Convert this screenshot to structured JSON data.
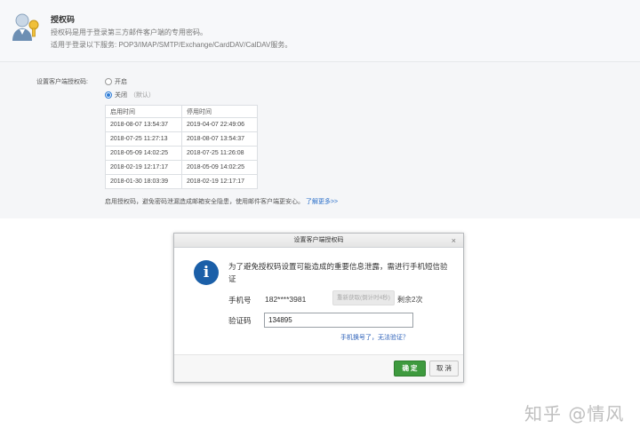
{
  "header": {
    "title": "授权码",
    "desc1": "授权码是用于登录第三方邮件客户端的专用密码。",
    "desc2": "适用于登录以下服务: POP3/IMAP/SMTP/Exchange/CardDAV/CalDAV服务。"
  },
  "setting": {
    "label": "设置客户端授权码:",
    "option_on": "开启",
    "option_off": "关闭",
    "option_off_hint": "（默认）",
    "selected": "关闭"
  },
  "history_table": {
    "headers": [
      "启用时间",
      "停用时间"
    ],
    "rows": [
      [
        "2018-08-07 13:54:37",
        "2019-04-07 22:49:06"
      ],
      [
        "2018-07-25 11:27:13",
        "2018-08-07 13:54:37"
      ],
      [
        "2018-05-09 14:02:25",
        "2018-07-25 11:26:08"
      ],
      [
        "2018-02-19 12:17:17",
        "2018-05-09 14:02:25"
      ],
      [
        "2018-01-30 18:03:39",
        "2018-02-19 12:17:17"
      ]
    ]
  },
  "footnote": {
    "text": "启用授权码，避免密码泄漏造成邮箱安全隐患，使用邮件客户端更安心。",
    "link": "了解更多>>"
  },
  "dialog": {
    "title": "设置客户端授权码",
    "close": "×",
    "message": "为了避免授权码设置可能造成的重要信息泄露，需进行手机短信验证",
    "phone_label": "手机号",
    "phone_value": "182****3981",
    "resend_label": "重新获取(倒计时4秒)",
    "remaining": "剩余2次",
    "code_label": "验证码",
    "code_value": "134895",
    "lost_phone_link": "手机换号了，无法验证？",
    "ok_label": "确 定",
    "cancel_label": "取 消"
  },
  "watermark": "知乎 @情风",
  "colors": {
    "accent": "#2a7ad6",
    "ok_button": "#3e9a3e",
    "link": "#2a6fc9",
    "info_icon": "#1b5fa8"
  }
}
